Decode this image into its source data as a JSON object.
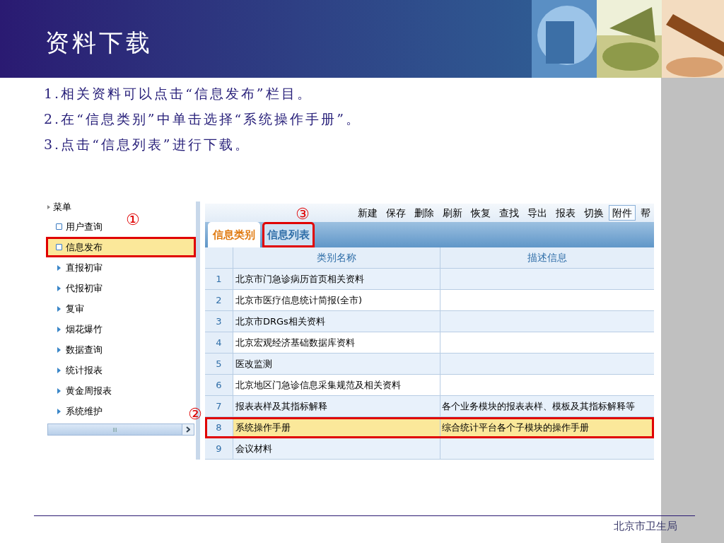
{
  "title": "资料下载",
  "steps": [
    "1.相关资料可以点击“信息发布”栏目。",
    "2.在“信息类别”中单击选择“系统操作手册”。",
    "3.点击“信息列表”进行下载。"
  ],
  "screenshot": {
    "menu": {
      "heading": "菜单",
      "items": [
        {
          "label": "用户查询",
          "kind": "page",
          "selected": false
        },
        {
          "label": "信息发布",
          "kind": "page",
          "selected": true,
          "highlighted": true
        },
        {
          "label": "直报初审",
          "kind": "folder",
          "selected": false
        },
        {
          "label": "代报初审",
          "kind": "folder",
          "selected": false
        },
        {
          "label": "复审",
          "kind": "folder",
          "selected": false
        },
        {
          "label": "烟花爆竹",
          "kind": "folder",
          "selected": false
        },
        {
          "label": "数据查询",
          "kind": "folder",
          "selected": false
        },
        {
          "label": "统计报表",
          "kind": "folder",
          "selected": false
        },
        {
          "label": "黄金周报表",
          "kind": "folder",
          "selected": false
        },
        {
          "label": "系统维护",
          "kind": "folder",
          "selected": false
        }
      ]
    },
    "toolbar": [
      {
        "label": "新建",
        "selected": false
      },
      {
        "label": "保存",
        "selected": false
      },
      {
        "label": "删除",
        "selected": false
      },
      {
        "label": "刷新",
        "selected": false
      },
      {
        "label": "恢复",
        "selected": false
      },
      {
        "label": "查找",
        "selected": false
      },
      {
        "label": "导出",
        "selected": false
      },
      {
        "label": "报表",
        "selected": false
      },
      {
        "label": "切换",
        "selected": false
      },
      {
        "label": "附件",
        "selected": true
      },
      {
        "label": "帮",
        "selected": false
      }
    ],
    "tabs": [
      {
        "label": "信息类别",
        "selected": true
      },
      {
        "label": "信息列表",
        "selected": false,
        "highlighted": true
      }
    ],
    "table": {
      "columns": [
        "类别名称",
        "描述信息"
      ],
      "rows": [
        {
          "number": "1",
          "name": "北京市门急诊病历首页相关资料",
          "selected": false
        },
        {
          "number": "2",
          "name": "北京市医疗信息统计简报(全市)",
          "selected": false
        },
        {
          "number": "3",
          "name": "北京市DRGs相关资料",
          "selected": false
        },
        {
          "number": "4",
          "name": "北京宏观经济基础数据库资料",
          "selected": false
        },
        {
          "number": "5",
          "name": "医改监测",
          "selected": false
        },
        {
          "number": "6",
          "name": "北京地区门急诊信息采集规范及相关资料",
          "selected": false
        },
        {
          "number": "7",
          "name": "报表表样及其指标解释",
          "description": "各个业务模块的报表表样、模板及其指标解释等",
          "selected": false
        },
        {
          "number": "8",
          "name": "系统操作手册",
          "description": "综合统计平台各个子模块的操作手册",
          "selected": true,
          "highlighted": true
        },
        {
          "number": "9",
          "name": "会议材料",
          "selected": false
        }
      ]
    },
    "callouts": [
      "①",
      "②",
      "③"
    ]
  },
  "footer": "北京市卫生局"
}
